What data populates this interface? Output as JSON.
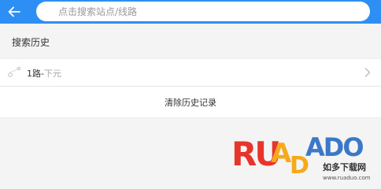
{
  "header": {
    "search_placeholder": "点击搜索站点/线路",
    "accent_color": "#2d8ef4",
    "back_icon": "arrow-left-icon"
  },
  "history": {
    "title": "搜索历史",
    "items": [
      {
        "route": "1路",
        "separator": "-",
        "destination": "下元",
        "icon": "bus-route-icon"
      }
    ],
    "clear_label": "清除历史记录"
  },
  "watermark": {
    "logo_text": "RUANDADO",
    "site_name": "如多下载网",
    "site_url": "www.ruaduo.com"
  }
}
